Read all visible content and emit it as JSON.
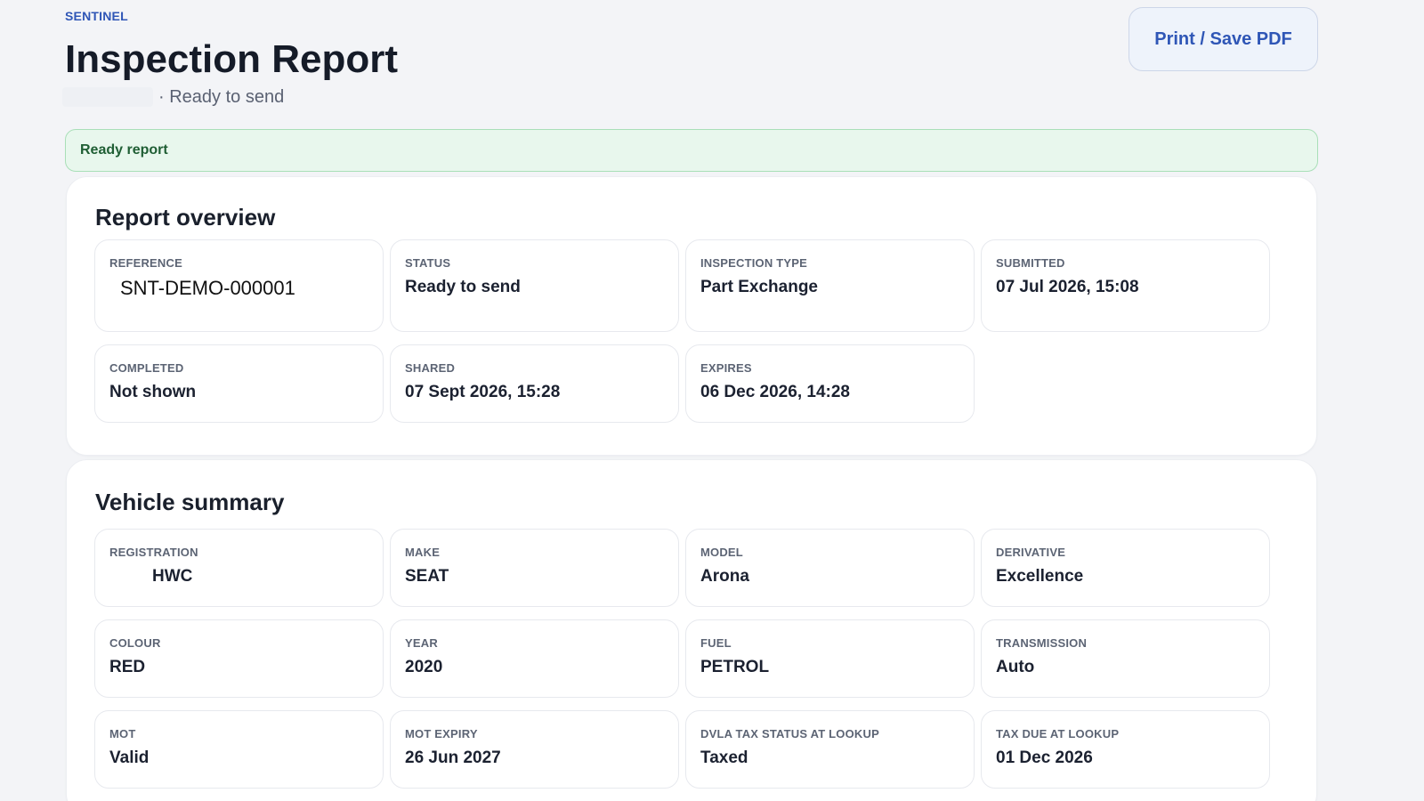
{
  "header": {
    "brand": "SENTINEL",
    "title": "Inspection Report",
    "subtitle": "· Ready to send",
    "print_label": "Print / Save PDF"
  },
  "banner": {
    "text": "Ready report"
  },
  "overview": {
    "title": "Report overview",
    "fields": [
      {
        "label": "REFERENCE",
        "value": "SNT-DEMO-000001"
      },
      {
        "label": "STATUS",
        "value": "Ready to send"
      },
      {
        "label": "INSPECTION TYPE",
        "value": "Part Exchange"
      },
      {
        "label": "SUBMITTED",
        "value": "07 Jul 2026, 15:08"
      },
      {
        "label": "COMPLETED",
        "value": "Not shown"
      },
      {
        "label": "SHARED",
        "value": "07 Sept 2026, 15:28"
      },
      {
        "label": "EXPIRES",
        "value": "06 Dec 2026, 14:28"
      }
    ]
  },
  "vehicle": {
    "title": "Vehicle summary",
    "fields": [
      {
        "label": "REGISTRATION",
        "value": "HWC"
      },
      {
        "label": "MAKE",
        "value": "SEAT"
      },
      {
        "label": "MODEL",
        "value": "Arona"
      },
      {
        "label": "DERIVATIVE",
        "value": "Excellence"
      },
      {
        "label": "COLOUR",
        "value": "RED"
      },
      {
        "label": "YEAR",
        "value": "2020"
      },
      {
        "label": "FUEL",
        "value": "PETROL"
      },
      {
        "label": "TRANSMISSION",
        "value": "Auto"
      },
      {
        "label": "MOT",
        "value": "Valid"
      },
      {
        "label": "MOT EXPIRY",
        "value": "26 Jun 2027"
      },
      {
        "label": "DVLA TAX STATUS AT LOOKUP",
        "value": "Taxed"
      },
      {
        "label": "TAX DUE AT LOOKUP",
        "value": "01 Dec 2026"
      }
    ]
  },
  "colors": {
    "accent": "#2f56b6",
    "banner_bg": "#e8f7ed",
    "banner_text": "#1f5e34",
    "page_bg": "#f3f4f7"
  }
}
